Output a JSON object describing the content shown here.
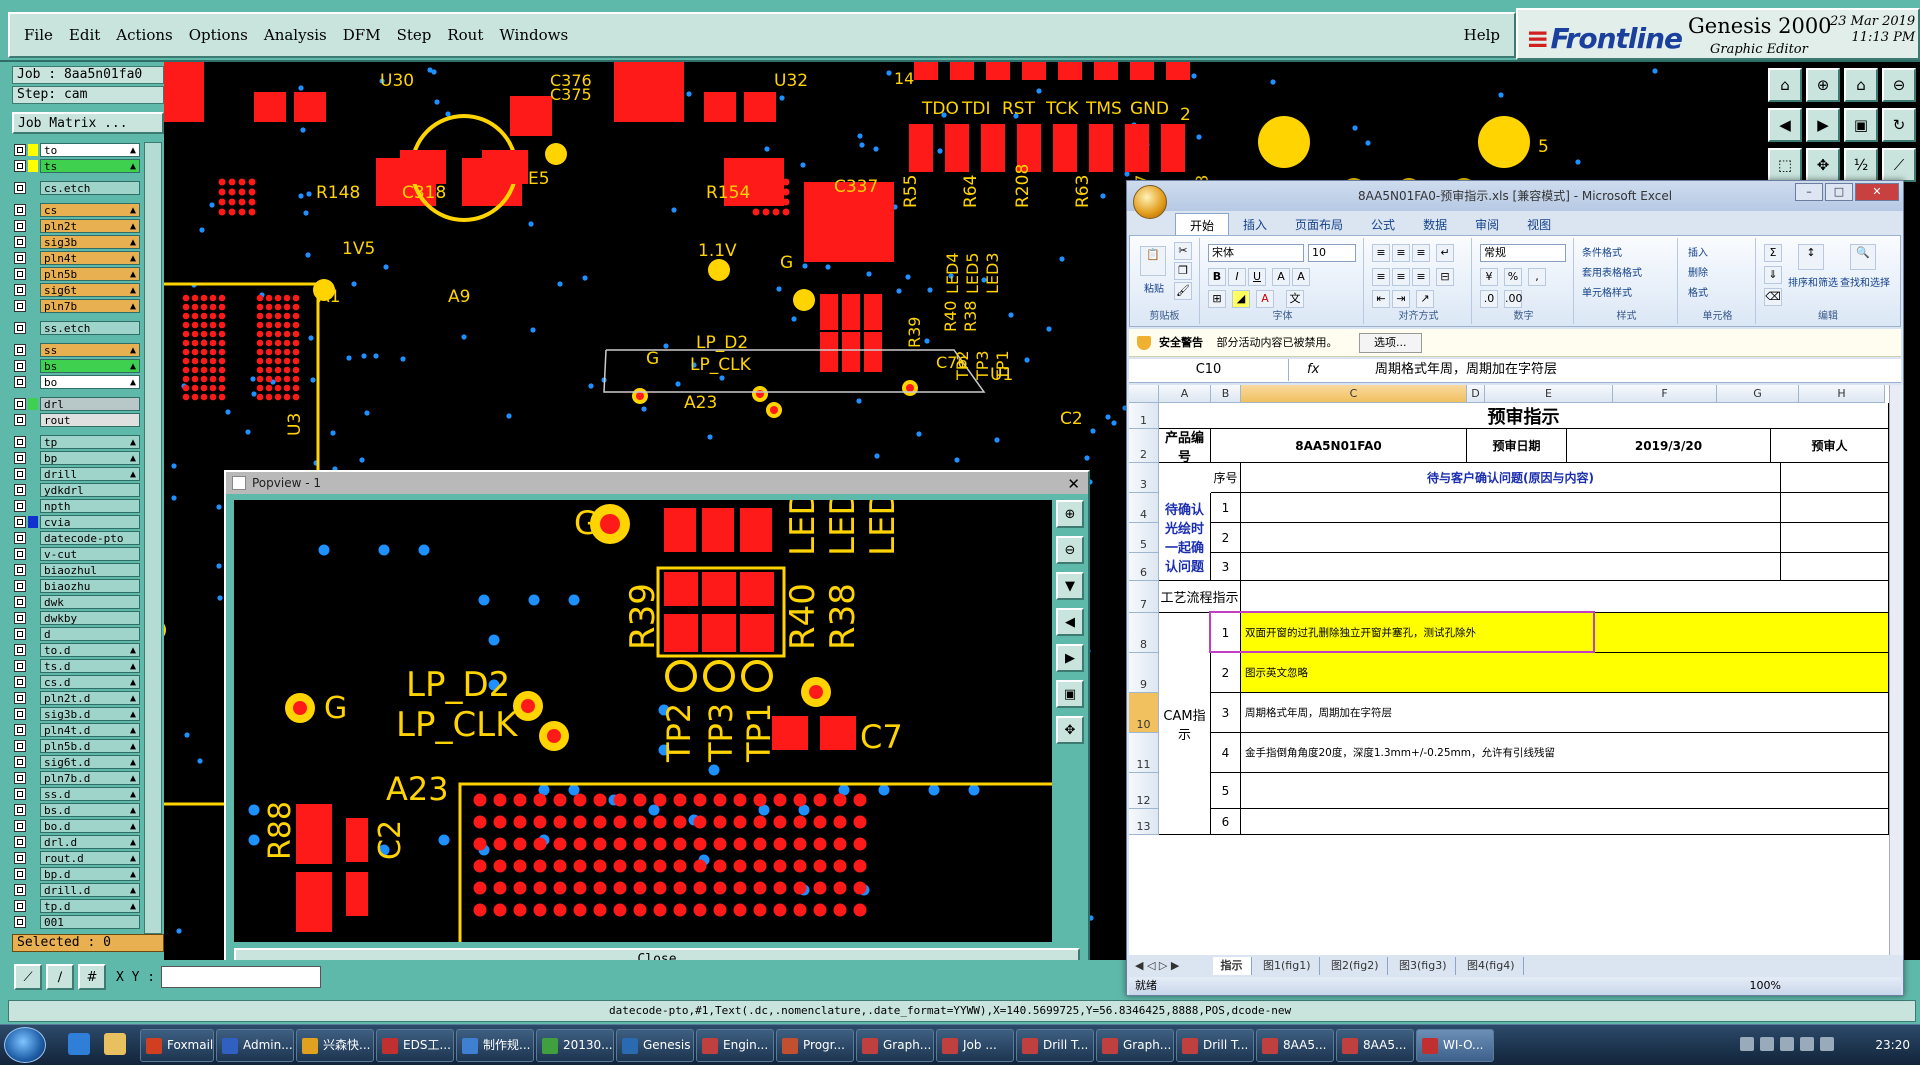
{
  "menu": {
    "items": [
      "File",
      "Edit",
      "Actions",
      "Options",
      "Analysis",
      "DFM",
      "Step",
      "Rout",
      "Windows"
    ],
    "help": "Help"
  },
  "brand": {
    "logo": "Frontline",
    "product": "Genesis 2000",
    "subtitle": "Graphic Editor",
    "date": "23 Mar 2019",
    "time": "11:13 PM"
  },
  "job": {
    "job_label": "Job : 8aa5n01fa0",
    "step_label": "Step: cam",
    "matrix_button": "Job Matrix ..."
  },
  "layers": [
    {
      "name": "to",
      "color": "#ffff00",
      "fill": "#ffffff",
      "dir": "▲"
    },
    {
      "name": "ts",
      "color": "#ffff00",
      "fill": "#3fd04f",
      "dir": "▲"
    },
    {
      "name": "cs.etch",
      "color": "#5fb9ab",
      "fill": "#9fd4ca",
      "dir": ""
    },
    {
      "name": "cs",
      "color": "#5fb9ab",
      "fill": "#e8b050",
      "dir": "▲"
    },
    {
      "name": "pln2t",
      "color": "#5fb9ab",
      "fill": "#e8b050",
      "dir": "▲"
    },
    {
      "name": "sig3b",
      "color": "#5fb9ab",
      "fill": "#e8b050",
      "dir": "▲"
    },
    {
      "name": "pln4t",
      "color": "#5fb9ab",
      "fill": "#e8b050",
      "dir": "▲"
    },
    {
      "name": "pln5b",
      "color": "#5fb9ab",
      "fill": "#e8b050",
      "dir": "▲"
    },
    {
      "name": "sig6t",
      "color": "#5fb9ab",
      "fill": "#e8b050",
      "dir": "▲"
    },
    {
      "name": "pln7b",
      "color": "#5fb9ab",
      "fill": "#e8b050",
      "dir": "▲"
    },
    {
      "name": "ss.etch",
      "color": "#5fb9ab",
      "fill": "#9fd4ca",
      "dir": ""
    },
    {
      "name": "ss",
      "color": "#5fb9ab",
      "fill": "#e8b050",
      "dir": "▲"
    },
    {
      "name": "bs",
      "color": "#5fb9ab",
      "fill": "#3fd04f",
      "dir": "▲"
    },
    {
      "name": "bo",
      "color": "#5fb9ab",
      "fill": "#ffffff",
      "dir": "▲"
    },
    {
      "name": "drl",
      "color": "#3fd04f",
      "fill": "#b8c8c8",
      "dir": ""
    },
    {
      "name": "rout",
      "color": "#5fb9ab",
      "fill": "#e0e0e0",
      "dir": ""
    },
    {
      "name": "tp",
      "color": "#5fb9ab",
      "fill": "#9fd4ca",
      "dir": "▲"
    },
    {
      "name": "bp",
      "color": "#5fb9ab",
      "fill": "#9fd4ca",
      "dir": "▲"
    },
    {
      "name": "drill",
      "color": "#5fb9ab",
      "fill": "#9fd4ca",
      "dir": "▲"
    },
    {
      "name": "ydkdrl",
      "color": "#5fb9ab",
      "fill": "#9fd4ca",
      "dir": ""
    },
    {
      "name": "npth",
      "color": "#5fb9ab",
      "fill": "#9fd4ca",
      "dir": ""
    },
    {
      "name": "cvia",
      "color": "#1030d0",
      "fill": "#9fd4ca",
      "dir": ""
    },
    {
      "name": "datecode-pto",
      "color": "#5fb9ab",
      "fill": "#9fd4ca",
      "dir": ""
    },
    {
      "name": "v-cut",
      "color": "#5fb9ab",
      "fill": "#9fd4ca",
      "dir": ""
    },
    {
      "name": "biaozhul",
      "color": "#5fb9ab",
      "fill": "#9fd4ca",
      "dir": ""
    },
    {
      "name": "biaozhu",
      "color": "#5fb9ab",
      "fill": "#9fd4ca",
      "dir": ""
    },
    {
      "name": "dwk",
      "color": "#5fb9ab",
      "fill": "#9fd4ca",
      "dir": ""
    },
    {
      "name": "dwkby",
      "color": "#5fb9ab",
      "fill": "#9fd4ca",
      "dir": ""
    },
    {
      "name": "d",
      "color": "#5fb9ab",
      "fill": "#9fd4ca",
      "dir": ""
    },
    {
      "name": "to.d",
      "color": "#5fb9ab",
      "fill": "#9fd4ca",
      "dir": "▲"
    },
    {
      "name": "ts.d",
      "color": "#5fb9ab",
      "fill": "#9fd4ca",
      "dir": "▲"
    },
    {
      "name": "cs.d",
      "color": "#5fb9ab",
      "fill": "#9fd4ca",
      "dir": "▲"
    },
    {
      "name": "pln2t.d",
      "color": "#5fb9ab",
      "fill": "#9fd4ca",
      "dir": "▲"
    },
    {
      "name": "sig3b.d",
      "color": "#5fb9ab",
      "fill": "#9fd4ca",
      "dir": "▲"
    },
    {
      "name": "pln4t.d",
      "color": "#5fb9ab",
      "fill": "#9fd4ca",
      "dir": "▲"
    },
    {
      "name": "pln5b.d",
      "color": "#5fb9ab",
      "fill": "#9fd4ca",
      "dir": "▲"
    },
    {
      "name": "sig6t.d",
      "color": "#5fb9ab",
      "fill": "#9fd4ca",
      "dir": "▲"
    },
    {
      "name": "pln7b.d",
      "color": "#5fb9ab",
      "fill": "#9fd4ca",
      "dir": "▲"
    },
    {
      "name": "ss.d",
      "color": "#5fb9ab",
      "fill": "#9fd4ca",
      "dir": "▲"
    },
    {
      "name": "bs.d",
      "color": "#5fb9ab",
      "fill": "#9fd4ca",
      "dir": "▲"
    },
    {
      "name": "bo.d",
      "color": "#5fb9ab",
      "fill": "#9fd4ca",
      "dir": "▲"
    },
    {
      "name": "drl.d",
      "color": "#5fb9ab",
      "fill": "#9fd4ca",
      "dir": "▲"
    },
    {
      "name": "rout.d",
      "color": "#5fb9ab",
      "fill": "#9fd4ca",
      "dir": "▲"
    },
    {
      "name": "bp.d",
      "color": "#5fb9ab",
      "fill": "#9fd4ca",
      "dir": "▲"
    },
    {
      "name": "drill.d",
      "color": "#5fb9ab",
      "fill": "#9fd4ca",
      "dir": "▲"
    },
    {
      "name": "tp.d",
      "color": "#5fb9ab",
      "fill": "#9fd4ca",
      "dir": "▲"
    },
    {
      "name": "001",
      "color": "#5fb9ab",
      "fill": "#9fd4ca",
      "dir": ""
    }
  ],
  "selected_label": "Selected : 0",
  "xy_label": "X Y :",
  "command_line": "datecode-pto,#1,Text(.dc,.nomenclature,.date_format=YYWW),X=140.5699725,Y=56.8346425,8888,POS,dcode-new",
  "pcb_labels": [
    "U30",
    "U32",
    "C376",
    "C375",
    "R148",
    "C318",
    "E5",
    "R154",
    "C337",
    "1V5",
    "1.1V",
    "G",
    "A1",
    "A9",
    "U3",
    "T1",
    "A1",
    "U2",
    "TDO",
    "TDI",
    "RST",
    "TCK",
    "TMS",
    "GND",
    "2",
    "8",
    "5",
    "14",
    "R55",
    "R64",
    "R208",
    "R63",
    "R57",
    "R53",
    "LED4",
    "LED5",
    "LED3",
    "R39",
    "R40",
    "R38",
    "LP_D2",
    "LP_CLK",
    "TP2",
    "TP3",
    "TP1",
    "C76",
    "U1",
    "A23",
    "C2",
    "G"
  ],
  "popview": {
    "title": "Popview - 1",
    "close_label": "Close",
    "labels": [
      "G",
      "LED",
      "LED",
      "LED",
      "R39",
      "R40",
      "R38",
      "LP_D2",
      "LP_CLK",
      "G",
      "TP2",
      "TP3",
      "TP1",
      "C7",
      "A23",
      "R88",
      "C2"
    ]
  },
  "excel": {
    "title": "8AA5N01FA0-预审指示.xls [兼容模式] - Microsoft Excel",
    "tabs": [
      "开始",
      "插入",
      "页面布局",
      "公式",
      "数据",
      "审阅",
      "视图"
    ],
    "ribbon": {
      "paste": "粘贴",
      "clipboard": "剪贴板",
      "font_name": "宋体",
      "font_size": "10",
      "font_group": "字体",
      "align_group": "对齐方式",
      "number_format": "常规",
      "number_group": "数字",
      "conditional": "条件格式",
      "table_style": "套用表格格式",
      "cell_style": "单元格样式",
      "style_group": "样式",
      "insert": "插入",
      "delete": "删除",
      "format": "格式",
      "cells_group": "单元格",
      "sort": "排序和筛选",
      "find": "查找和选择",
      "edit_group": "编辑"
    },
    "security_title": "安全警告",
    "security_text": "部分活动内容已被禁用。",
    "security_button": "选项...",
    "name_box": "C10",
    "fx": "fx",
    "formula": "周期格式年周，周期加在字符层",
    "columns": [
      "A",
      "B",
      "C",
      "D",
      "E",
      "F",
      "G",
      "H"
    ],
    "rows": [
      "1",
      "2",
      "3",
      "4",
      "5",
      "6",
      "7",
      "8",
      "9",
      "10",
      "11",
      "12",
      "13"
    ],
    "cells": {
      "title": "预审指示",
      "product_label": "产品编号",
      "product_no": "8AA5N01FA0",
      "review_date_label": "预审日期",
      "review_date": "2019/3/20",
      "reviewer_label": "预审人",
      "seq_label": "序号",
      "question_header": "待与客户确认问题(原因与内容)",
      "confirm_label": "待确认光绘时一起确认问题",
      "seq1": "1",
      "seq2": "2",
      "seq3": "3",
      "process_label": "工艺流程指示",
      "cam_label": "CAM指示",
      "cam_seq": [
        "1",
        "2",
        "3",
        "4",
        "5",
        "6"
      ],
      "cam_items": [
        "双面开窗的过孔删除独立开窗并塞孔，测试孔除外",
        "图示英文忽略",
        "周期格式年周，周期加在字符层",
        "金手指倒角角度20度，深度1.3mm+/-0.25mm，允许有引线残留",
        "",
        ""
      ]
    },
    "sheet_tabs": [
      "指示",
      "图1(fig1)",
      "图2(fig2)",
      "图3(fig3)",
      "图4(fig4)"
    ],
    "status": "就绪",
    "zoom": "100%"
  },
  "taskbar": {
    "items": [
      "Foxmail",
      "Admin...",
      "兴森快...",
      "EDS工...",
      "制作规...",
      "20130...",
      "Genesis",
      "Engin...",
      "Progr...",
      "Graph...",
      "Job ...",
      "Drill T...",
      "Graph...",
      "Drill T...",
      "8AA5...",
      "8AA5...",
      "WI-O..."
    ],
    "clock": "23:20"
  }
}
